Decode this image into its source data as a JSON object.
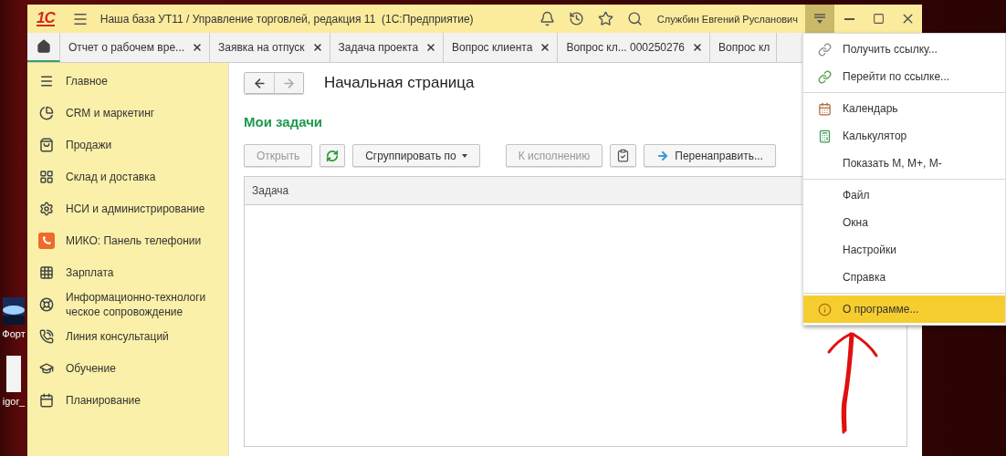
{
  "desktop": {
    "icons": [
      {
        "label": "Форт",
        "kind": "picture"
      },
      {
        "label": "igor_",
        "kind": "file"
      }
    ]
  },
  "window": {
    "logo": "1С",
    "title": "Наша база УТ11 / Управление торговлей, редакция 11  (1С:Предприятие)",
    "user": "Службин Евгений Русланович",
    "menu_open": true
  },
  "tabs": [
    {
      "kind": "home",
      "selected": true
    },
    {
      "label": "Отчет о рабочем вре...",
      "kind": "doc",
      "selected": false
    },
    {
      "label": "Заявка на отпуск",
      "kind": "doc",
      "selected": false
    },
    {
      "label": "Задача проекта",
      "kind": "doc",
      "selected": false
    },
    {
      "label": "Вопрос клиента",
      "kind": "doc",
      "selected": false
    },
    {
      "label": "Вопрос кл... 000250276",
      "kind": "doc",
      "selected": false
    },
    {
      "label": "Вопрос кл",
      "kind": "cut",
      "selected": false
    }
  ],
  "sidebar": {
    "items": [
      {
        "label": "Главное"
      },
      {
        "label": "CRM и маркетинг"
      },
      {
        "label": "Продажи"
      },
      {
        "label": "Склад и доставка"
      },
      {
        "label": "НСИ и администрирование"
      },
      {
        "label": "МИКО: Панель телефонии"
      },
      {
        "label": "Зарплата"
      },
      {
        "label": "Информационно-технологи ческое сопровождение"
      },
      {
        "label": "Линия консультаций"
      },
      {
        "label": "Обучение"
      },
      {
        "label": "Планирование"
      }
    ]
  },
  "content": {
    "nav": {
      "back_disabled": false,
      "forward_disabled": true
    },
    "title": "Начальная страница",
    "section": "Мои задачи",
    "toolbar": [
      {
        "kind": "text",
        "label": "Открыть",
        "disabled": true
      },
      {
        "kind": "refresh"
      },
      {
        "kind": "dropdown",
        "label": "Сгруппировать по",
        "disabled": false
      },
      {
        "kind": "text",
        "label": "К исполнению",
        "disabled": true
      },
      {
        "kind": "clipboard"
      },
      {
        "kind": "forward",
        "label": "Перенаправить...",
        "disabled": false
      }
    ],
    "table": {
      "columns": [
        "Задача"
      ]
    }
  },
  "menu": {
    "groups": [
      [
        {
          "label": "Получить ссылку...",
          "selected": false
        },
        {
          "label": "Перейти по ссылке...",
          "selected": false
        }
      ],
      [
        {
          "label": "Календарь",
          "selected": false
        },
        {
          "label": "Калькулятор",
          "selected": false
        },
        {
          "label": "Показать M, M+, M-",
          "selected": false
        }
      ],
      [
        {
          "label": "Файл",
          "selected": false
        },
        {
          "label": "Окна",
          "selected": false
        },
        {
          "label": "Настройки",
          "selected": false
        },
        {
          "label": "Справка",
          "selected": false
        }
      ],
      [
        {
          "label": "О программе...",
          "selected": true
        }
      ]
    ]
  },
  "annotation": {
    "kind": "arrow"
  }
}
